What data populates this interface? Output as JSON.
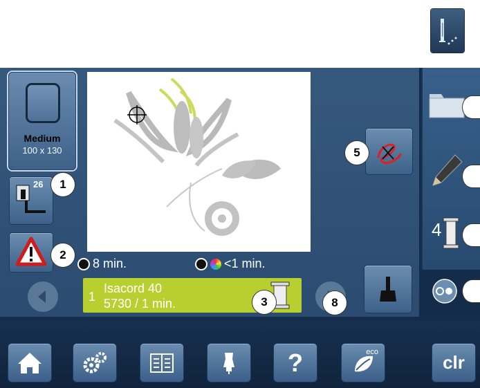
{
  "hoop": {
    "label": "Medium",
    "size": "100 x 130"
  },
  "presser_foot": {
    "number": "26"
  },
  "badges": {
    "b1": "1",
    "b2": "2",
    "b3": "3",
    "b5": "5",
    "b8": "8"
  },
  "times": {
    "total": "8 min.",
    "color": "<1 min."
  },
  "thread": {
    "index": "1",
    "name": "Isacord 40",
    "code": "5730 / 1 min."
  },
  "thread_count": "4",
  "bottom": {
    "clr": "clr",
    "help": "?",
    "eco": "eco"
  },
  "colors": {
    "thread_bar": "#b7cf2f",
    "screen_bg": "#142c49",
    "warning": "#d01c1c"
  }
}
